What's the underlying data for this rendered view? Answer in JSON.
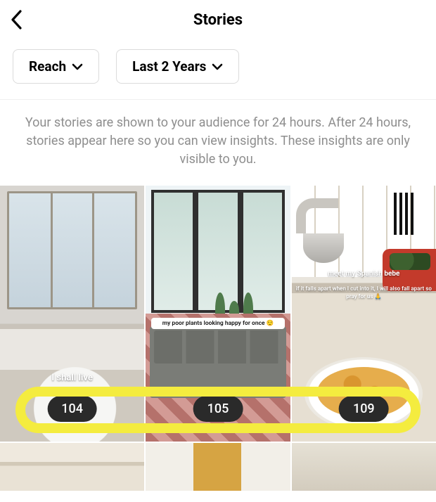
{
  "header": {
    "title": "Stories"
  },
  "filters": {
    "metric": "Reach",
    "range": "Last 2 Years"
  },
  "info_text": "Your stories are shown to your audience for 24 hours. After 24 hours, stories appear here so you can view insights. These insights are only visible to you.",
  "stories": [
    {
      "caption": "I shall live",
      "reach": "104"
    },
    {
      "caption": "my poor plants looking happy for once 😌",
      "reach": "105"
    },
    {
      "caption_line1": "meet my Spanish bebe",
      "caption_line2": "if it falls apart when I cut into it, I will also fall apart so pray for us 🙏",
      "reach": "109"
    }
  ]
}
